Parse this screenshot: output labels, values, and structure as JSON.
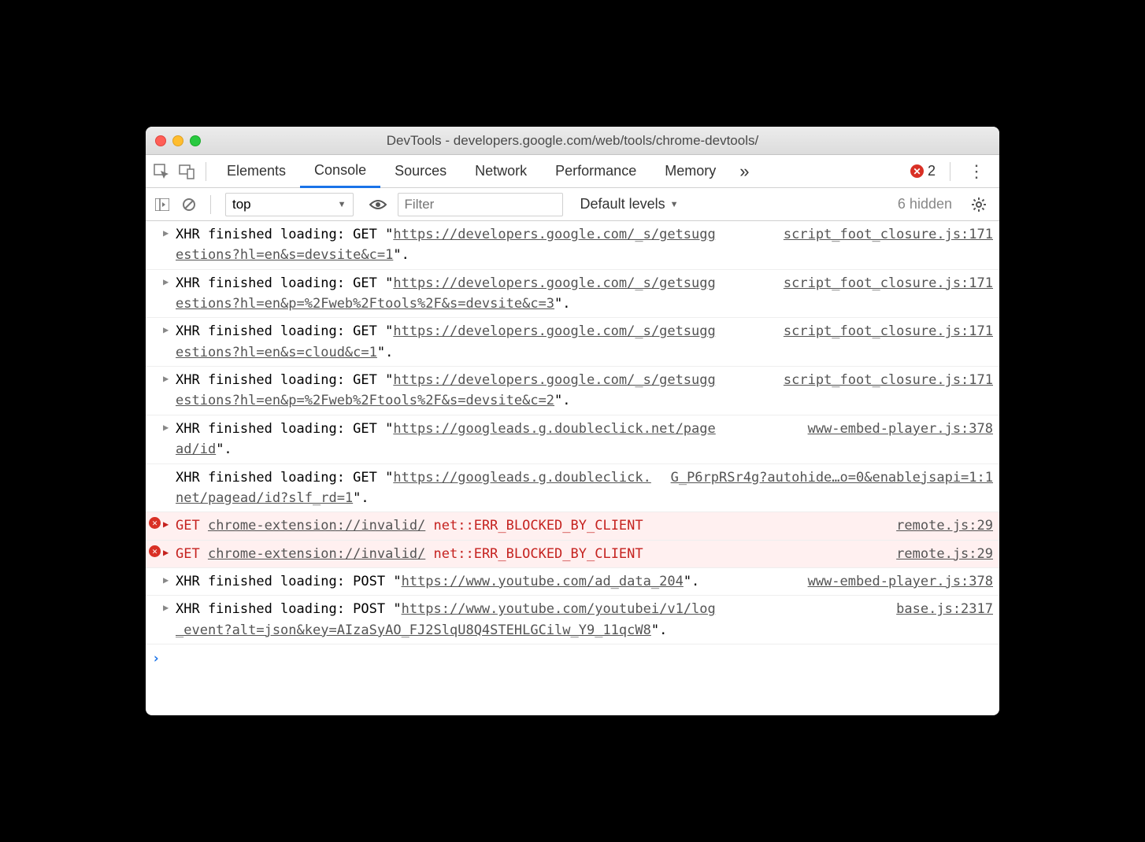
{
  "window": {
    "title": "DevTools - developers.google.com/web/tools/chrome-devtools/"
  },
  "toolbar": {
    "tabs": [
      "Elements",
      "Console",
      "Sources",
      "Network",
      "Performance",
      "Memory"
    ],
    "active": "Console",
    "error_count": "2"
  },
  "subbar": {
    "context": "top",
    "filter_placeholder": "Filter",
    "levels": "Default levels",
    "hidden": "6 hidden"
  },
  "log": [
    {
      "type": "xhr",
      "prefix": "XHR finished loading: GET \"",
      "url": "https://developers.google.com/_s/getsuggestions?hl=en&s=devsite&c=1",
      "suffix": "\".",
      "src": "script_foot_closure.js:171",
      "arrow": true
    },
    {
      "type": "xhr",
      "prefix": "XHR finished loading: GET \"",
      "url": "https://developers.google.com/_s/getsuggestions?hl=en&p=%2Fweb%2Ftools%2F&s=devsite&c=3",
      "suffix": "\".",
      "src": "script_foot_closure.js:171",
      "arrow": true
    },
    {
      "type": "xhr",
      "prefix": "XHR finished loading: GET \"",
      "url": "https://developers.google.com/_s/getsuggestions?hl=en&s=cloud&c=1",
      "suffix": "\".",
      "src": "script_foot_closure.js:171",
      "arrow": true
    },
    {
      "type": "xhr",
      "prefix": "XHR finished loading: GET \"",
      "url": "https://developers.google.com/_s/getsuggestions?hl=en&p=%2Fweb%2Ftools%2F&s=devsite&c=2",
      "suffix": "\".",
      "src": "script_foot_closure.js:171",
      "arrow": true
    },
    {
      "type": "xhr",
      "prefix": "XHR finished loading: GET \"",
      "url": "https://googleads.g.doubleclick.net/pagead/id",
      "suffix": "\".",
      "src": "www-embed-player.js:378",
      "arrow": true
    },
    {
      "type": "xhr",
      "prefix": "XHR finished loading: GET \"",
      "url": "https://googleads.g.doubleclick.net/pagead/id?slf_rd=1",
      "suffix": "\".",
      "src": "G_P6rpRSr4g?autohide…o=0&enablejsapi=1:1",
      "arrow": false
    },
    {
      "type": "error",
      "method": "GET",
      "url": "chrome-extension://invalid/",
      "err": "net::ERR_BLOCKED_BY_CLIENT",
      "src": "remote.js:29",
      "arrow": true
    },
    {
      "type": "error",
      "method": "GET",
      "url": "chrome-extension://invalid/",
      "err": "net::ERR_BLOCKED_BY_CLIENT",
      "src": "remote.js:29",
      "arrow": true
    },
    {
      "type": "xhr",
      "prefix": "XHR finished loading: POST \"",
      "url": "https://www.youtube.com/ad_data_204",
      "suffix": "\".",
      "src": "www-embed-player.js:378",
      "arrow": true
    },
    {
      "type": "xhr",
      "prefix": "XHR finished loading: POST \"",
      "url": "https://www.youtube.com/youtubei/v1/log_event?alt=json&key=AIzaSyAO_FJ2SlqU8Q4STEHLGCilw_Y9_11qcW8",
      "suffix": "\".",
      "src": "base.js:2317",
      "arrow": true
    }
  ]
}
